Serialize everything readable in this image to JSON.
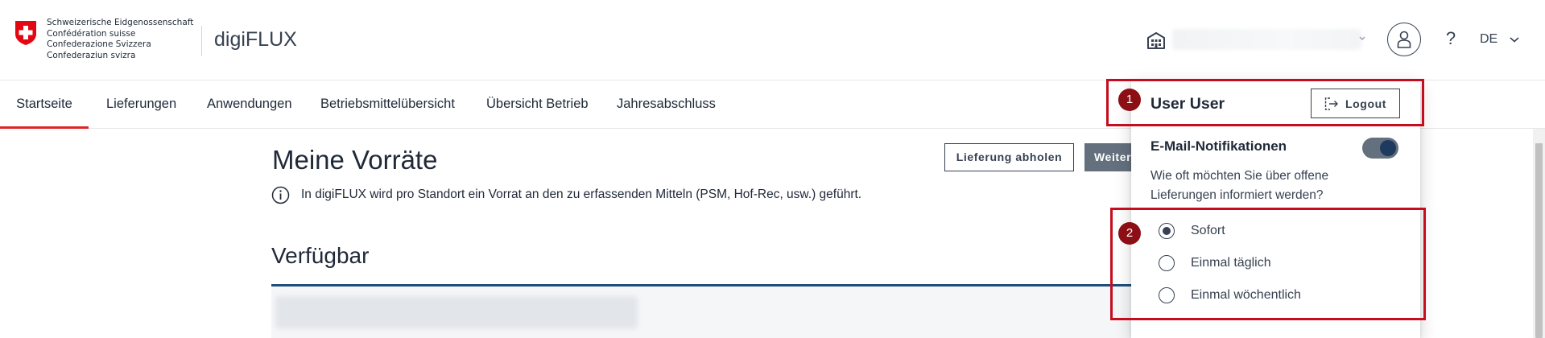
{
  "header": {
    "confederation_lines": [
      "Schweizerische Eidgenossenschaft",
      "Confédération suisse",
      "Confederazione Svizzera",
      "Confederaziun svizra"
    ],
    "app_title": "digiFLUX",
    "farm_icon": "farm-building-icon",
    "user_icon": "user-icon",
    "help_label": "?",
    "language": "DE"
  },
  "nav": {
    "items": [
      {
        "label": "Startseite",
        "active": true
      },
      {
        "label": "Lieferungen",
        "active": false
      },
      {
        "label": "Anwendungen",
        "active": false
      },
      {
        "label": "Betriebsmittelübersicht",
        "active": false
      },
      {
        "label": "Übersicht Betrieb",
        "active": false
      },
      {
        "label": "Jahresabschluss",
        "active": false
      }
    ]
  },
  "main": {
    "title": "Meine Vorräte",
    "btn_fetch": "Lieferung abholen",
    "btn_next": "Weiter",
    "info_text": "In digiFLUX wird pro Standort ein Vorrat an den zu erfassenden Mitteln (PSM, Hof-Rec, usw.) geführt.",
    "section_title": "Verfügbar"
  },
  "dropdown": {
    "user_name": "User User",
    "logout_label": "Logout",
    "email_label": "E-Mail-Notifikationen",
    "email_enabled": true,
    "question": "Wie oft möchten Sie über offene Lieferungen informiert werden?",
    "options": [
      {
        "label": "Sofort",
        "checked": true
      },
      {
        "label": "Einmal täglich",
        "checked": false
      },
      {
        "label": "Einmal wöchentlich",
        "checked": false
      }
    ]
  },
  "annotations": [
    "1",
    "2"
  ],
  "colors": {
    "accent_red": "#dc2626",
    "annotation_red": "#c40d1e",
    "badge_red": "#8b0f14",
    "button_gray": "#64707d",
    "table_border_blue": "#1e4f7a"
  }
}
